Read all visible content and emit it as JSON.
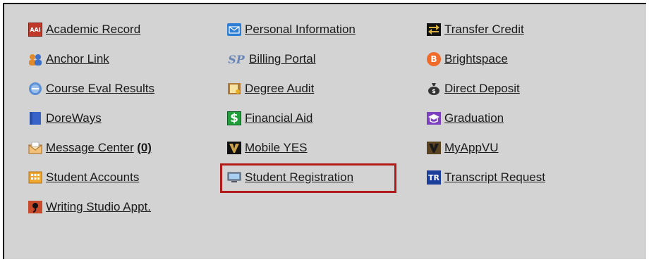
{
  "links": {
    "col1": [
      {
        "label": "Academic Record",
        "icon": "academic-record-icon"
      },
      {
        "label": "Anchor Link",
        "icon": "anchor-link-icon"
      },
      {
        "label": "Course Eval Results",
        "icon": "course-eval-icon"
      },
      {
        "label": "DoreWays",
        "icon": "doreways-icon"
      },
      {
        "label": "Message Center",
        "count": "(0)",
        "icon": "message-center-icon"
      },
      {
        "label": "Student Accounts",
        "icon": "student-accounts-icon"
      },
      {
        "label": "Writing Studio Appt.",
        "icon": "writing-studio-icon"
      }
    ],
    "col2": [
      {
        "label": "Personal Information",
        "icon": "envelope-icon"
      },
      {
        "label": "Billing Portal",
        "icon": "sp-logo-icon",
        "icon_text": "SP"
      },
      {
        "label": "Degree Audit",
        "icon": "degree-audit-icon"
      },
      {
        "label": "Financial Aid",
        "icon": "dollar-icon",
        "icon_text": "$"
      },
      {
        "label": "Mobile YES",
        "icon": "vanderbilt-v-icon"
      },
      {
        "label": "Student Registration",
        "icon": "monitor-icon"
      }
    ],
    "col3": [
      {
        "label": "Transfer Credit",
        "icon": "transfer-arrows-icon"
      },
      {
        "label": "Brightspace",
        "icon": "brightspace-icon",
        "icon_text": "B"
      },
      {
        "label": "Direct Deposit",
        "icon": "money-bag-icon"
      },
      {
        "label": "Graduation",
        "icon": "graduation-cap-icon"
      },
      {
        "label": "MyAppVU",
        "icon": "vanderbilt-v-icon"
      },
      {
        "label": "Transcript Request",
        "icon": "tr-logo-icon",
        "icon_text": "TR"
      }
    ]
  },
  "icon_badges": {
    "academic_record": "AAI"
  },
  "colors": {
    "panel_bg": "#d3d3d3",
    "highlight": "#b31b1b",
    "link_text": "#1a1a1a"
  }
}
